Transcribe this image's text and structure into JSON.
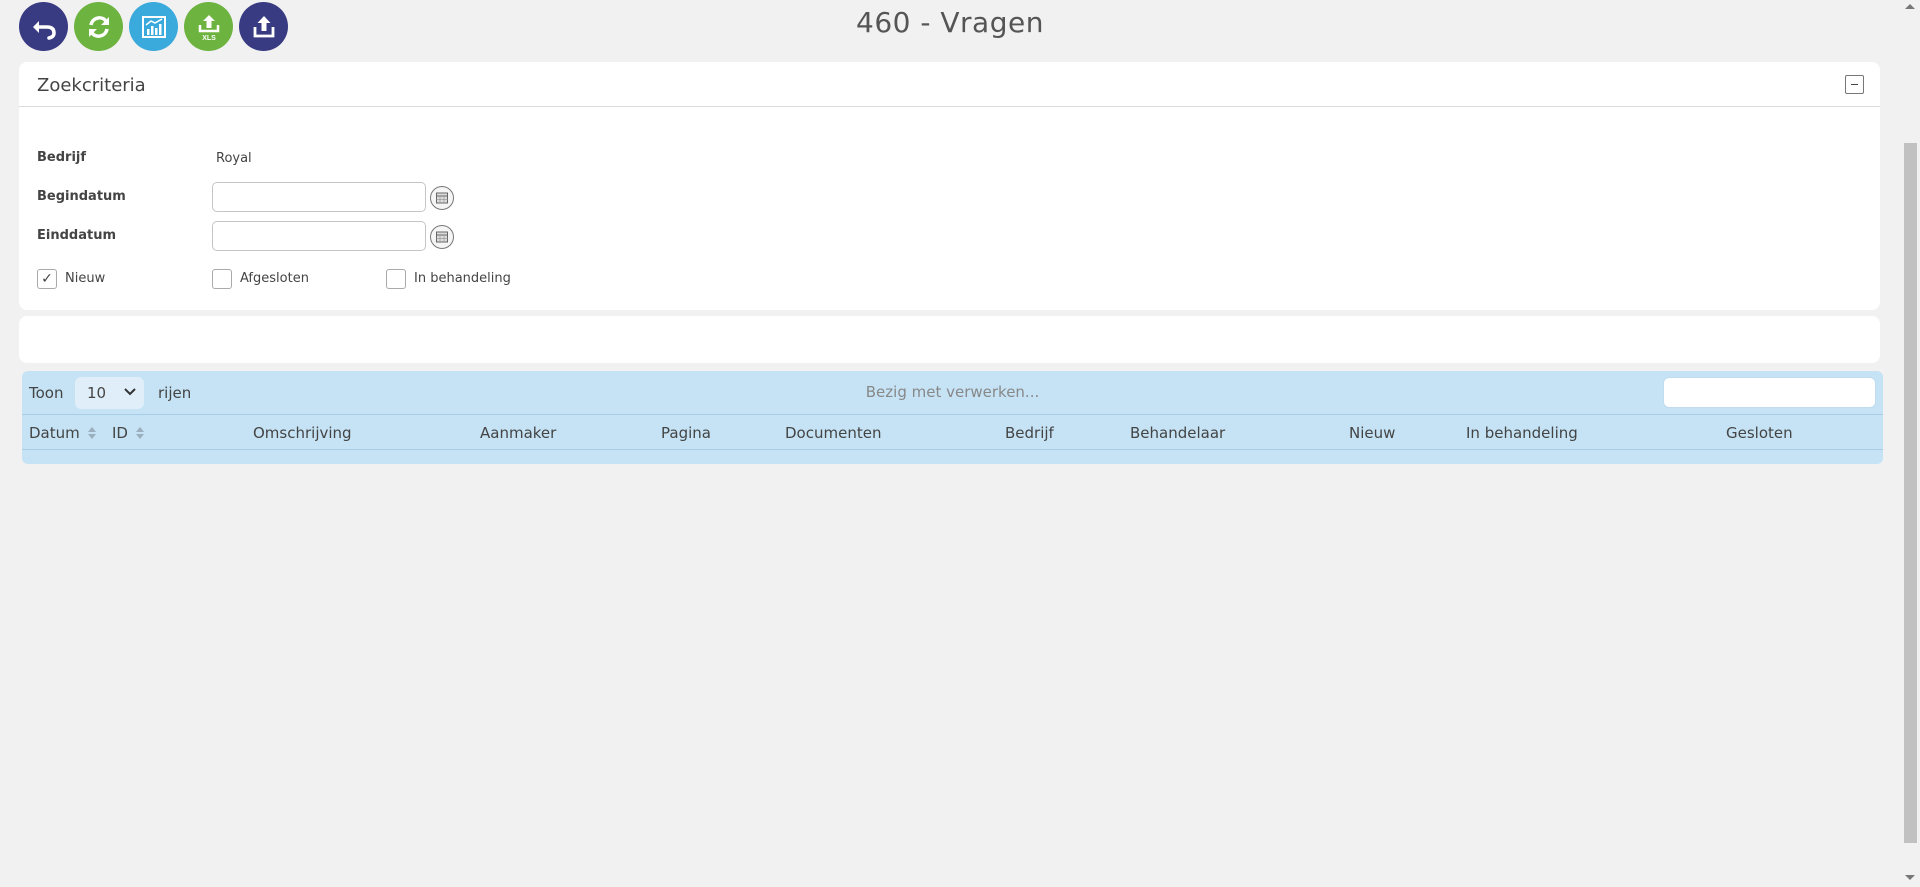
{
  "toolbar": {
    "buttons": [
      {
        "icon": "back-arrow-icon",
        "color": "#383a82"
      },
      {
        "icon": "refresh-icon",
        "color": "#6db33f"
      },
      {
        "icon": "chart-icon",
        "color": "#3aa9dc"
      },
      {
        "icon": "export-xls-icon",
        "color": "#6db33f",
        "badge": "XLS"
      },
      {
        "icon": "export-icon",
        "color": "#383a82"
      }
    ]
  },
  "page": {
    "title": "460 - Vragen"
  },
  "criteria": {
    "title": "Zoekcriteria",
    "bedrijf_label": "Bedrijf",
    "bedrijf_value": "Royal",
    "begindatum_label": "Begindatum",
    "begindatum_value": "",
    "einddatum_label": "Einddatum",
    "einddatum_value": "",
    "checks": [
      {
        "label": "Nieuw",
        "checked": true,
        "mark": "✓"
      },
      {
        "label": "Afgesloten",
        "checked": false
      },
      {
        "label": "In behandeling",
        "checked": false
      }
    ]
  },
  "table": {
    "show_label": "Toon",
    "rows_value": "10",
    "rows_label": "rijen",
    "processing": "Bezig met verwerken...",
    "search_value": "",
    "columns": [
      "Datum",
      "ID",
      "Omschrijving",
      "Aanmaker",
      "Pagina",
      "Documenten",
      "Bedrijf",
      "Behandelaar",
      "Nieuw",
      "In behandeling",
      "Gesloten"
    ]
  },
  "colors": {
    "background": "#f1f1f1",
    "table_header": "#c5e3f5",
    "navy": "#383a82",
    "green": "#6db33f",
    "sky": "#3aa9dc"
  }
}
